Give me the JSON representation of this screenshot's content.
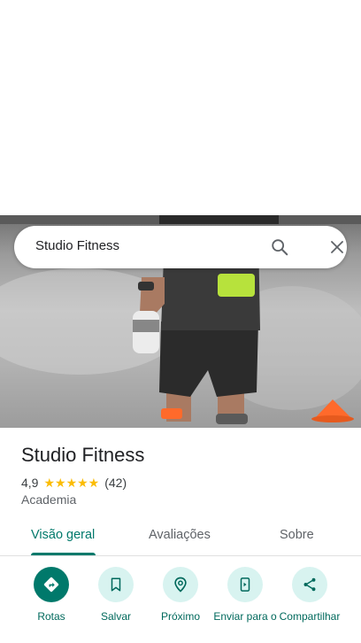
{
  "search": {
    "query": "Studio Fitness"
  },
  "place": {
    "name": "Studio Fitness",
    "rating": "4,9",
    "stars": "★★★★★",
    "review_count": "(42)",
    "category": "Academia"
  },
  "tabs": [
    {
      "label": "Visão geral",
      "active": true
    },
    {
      "label": "Avaliações",
      "active": false
    },
    {
      "label": "Sobre",
      "active": false
    }
  ],
  "actions": [
    {
      "label": "Rotas",
      "icon": "directions-icon"
    },
    {
      "label": "Salvar",
      "icon": "bookmark-icon"
    },
    {
      "label": "Próximo",
      "icon": "nearby-icon"
    },
    {
      "label": "Enviar para o",
      "icon": "send-to-phone-icon"
    },
    {
      "label": "Compartilhar",
      "icon": "share-icon"
    }
  ],
  "colors": {
    "accent": "#00796b",
    "action_bg": "#d8f3f0",
    "star": "#fbbc04"
  }
}
